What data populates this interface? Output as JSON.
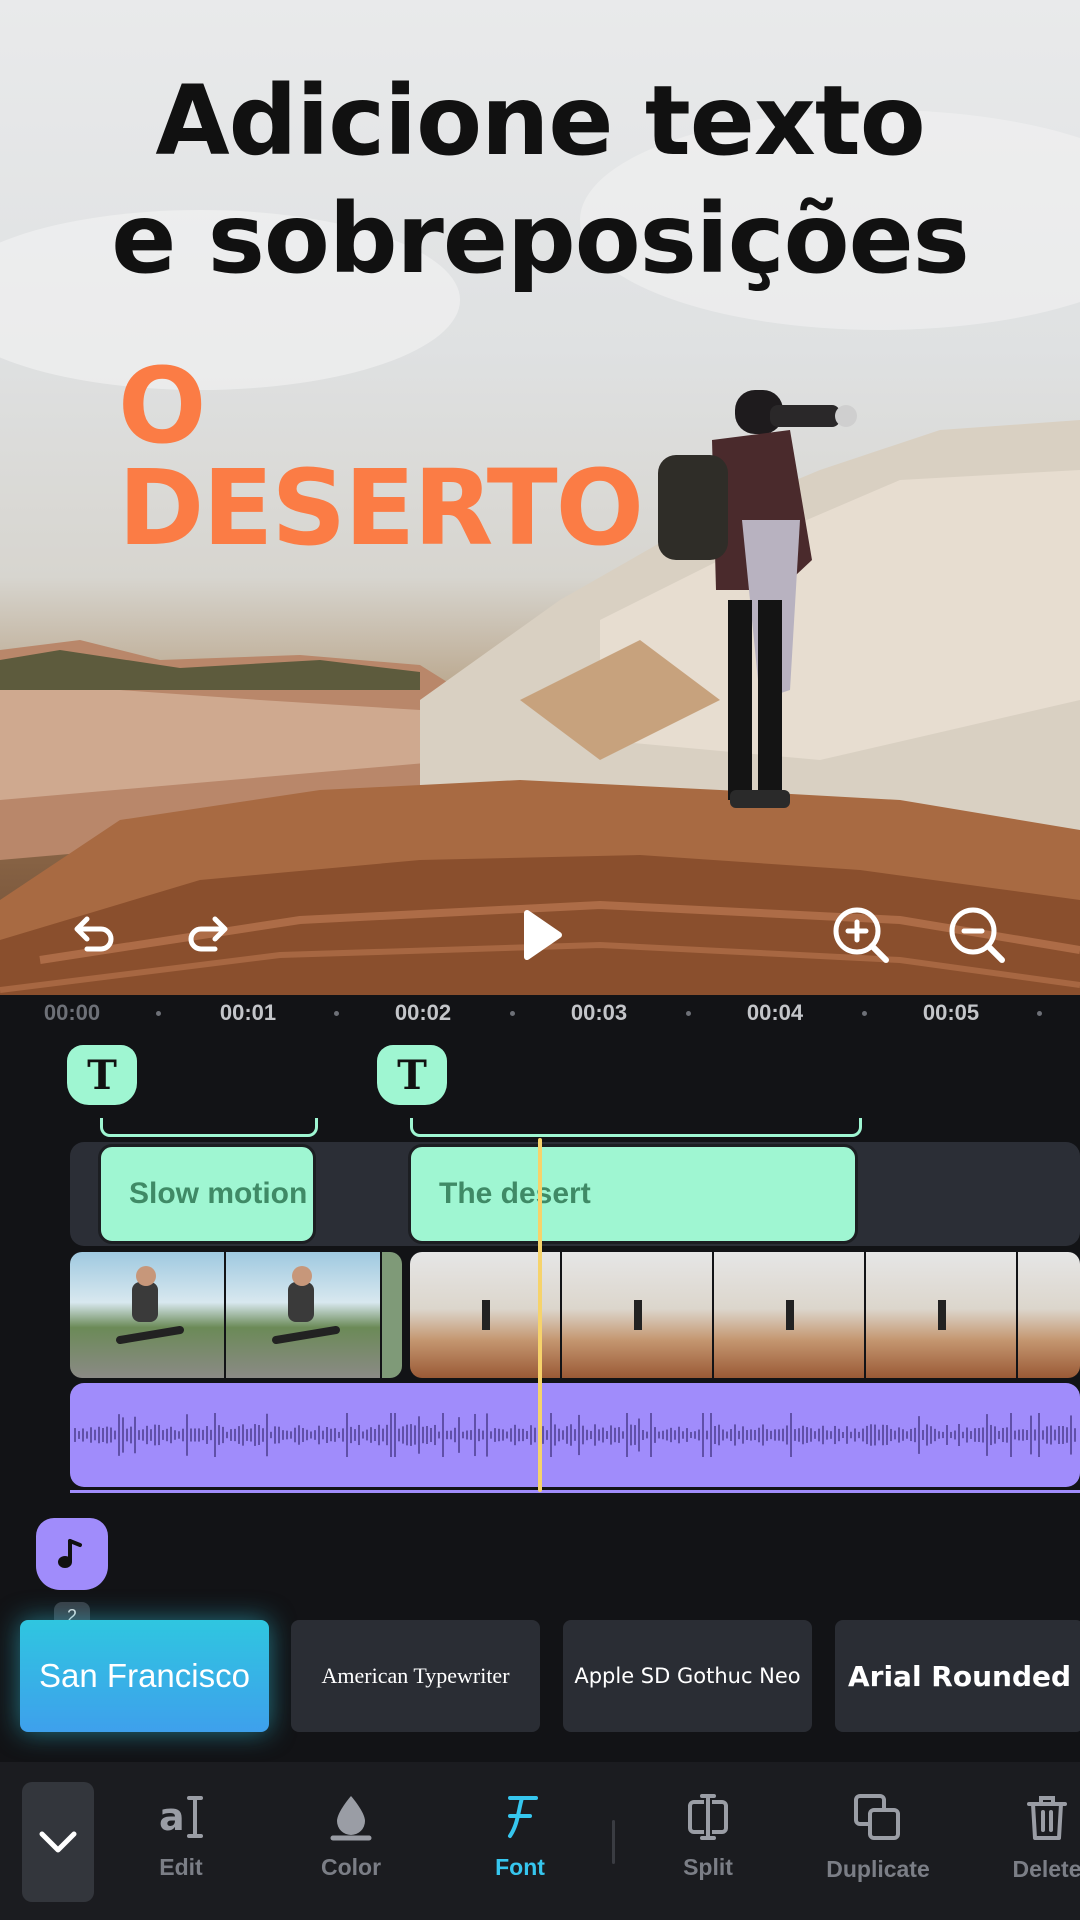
{
  "headline": {
    "line1": "Adicione texto",
    "line2": "e sobreposições"
  },
  "overlay": {
    "line1": "O",
    "line2": "DESERTO"
  },
  "ruler": {
    "ticks": [
      "00:00",
      "00:01",
      "00:02",
      "00:03",
      "00:04",
      "00:05"
    ]
  },
  "timeline": {
    "text_clips": [
      "Slow motion",
      "The desert"
    ],
    "text_marker_glyph": "T",
    "music_badge": "2"
  },
  "fonts": {
    "items": [
      "San Francisco",
      "American Typewriter",
      "Apple SD Gothuc Neo",
      "Arial Rounded"
    ],
    "selected": "San Francisco"
  },
  "toolbar": {
    "edit_label": "Edit",
    "color_label": "Color",
    "font_label": "Font",
    "split_label": "Split",
    "duplicate_label": "Duplicate",
    "delete_label": "Delete",
    "active": "Font"
  },
  "colors": {
    "text_accent": "#9ff6d2",
    "audio_accent": "#a08cfb",
    "playhead": "#f6d36b",
    "overlay_orange": "#fb7c45",
    "active_tool": "#36c6ee"
  },
  "icons": [
    "undo-icon",
    "redo-icon",
    "play-icon",
    "zoom-in-icon",
    "zoom-out-icon",
    "chevron-down-icon",
    "music-note-icon"
  ]
}
